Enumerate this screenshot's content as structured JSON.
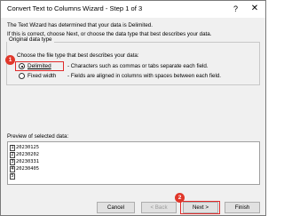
{
  "window": {
    "title": "Convert Text to Columns Wizard - Step 1 of 3",
    "help_label": "?",
    "close_label": "✕"
  },
  "intro": {
    "line1": "The Text Wizard has determined that your data is Delimited.",
    "line2": "If this is correct, choose Next, or choose the data type that best describes your data."
  },
  "original_data_type": {
    "group_title": "Original data type",
    "prompt": "Choose the file type that best describes your data:",
    "options": [
      {
        "label": "Delimited",
        "description": "- Characters such as commas or tabs separate each field.",
        "selected": true
      },
      {
        "label": "Fixed width",
        "description": "- Fields are aligned in columns with spaces between each field.",
        "selected": false
      }
    ]
  },
  "preview": {
    "label": "Preview of selected data:",
    "rows": [
      {
        "num": "1",
        "text": "20230125"
      },
      {
        "num": "2",
        "text": "20230202"
      },
      {
        "num": "3",
        "text": "20230331"
      },
      {
        "num": "4",
        "text": "20230405"
      },
      {
        "num": "5",
        "text": ""
      }
    ]
  },
  "buttons": {
    "cancel": "Cancel",
    "back": "< Back",
    "next": "Next >",
    "finish": "Finish"
  },
  "annotations": {
    "step1": "1",
    "step2": "2",
    "highlight_color": "#e02a2a"
  }
}
